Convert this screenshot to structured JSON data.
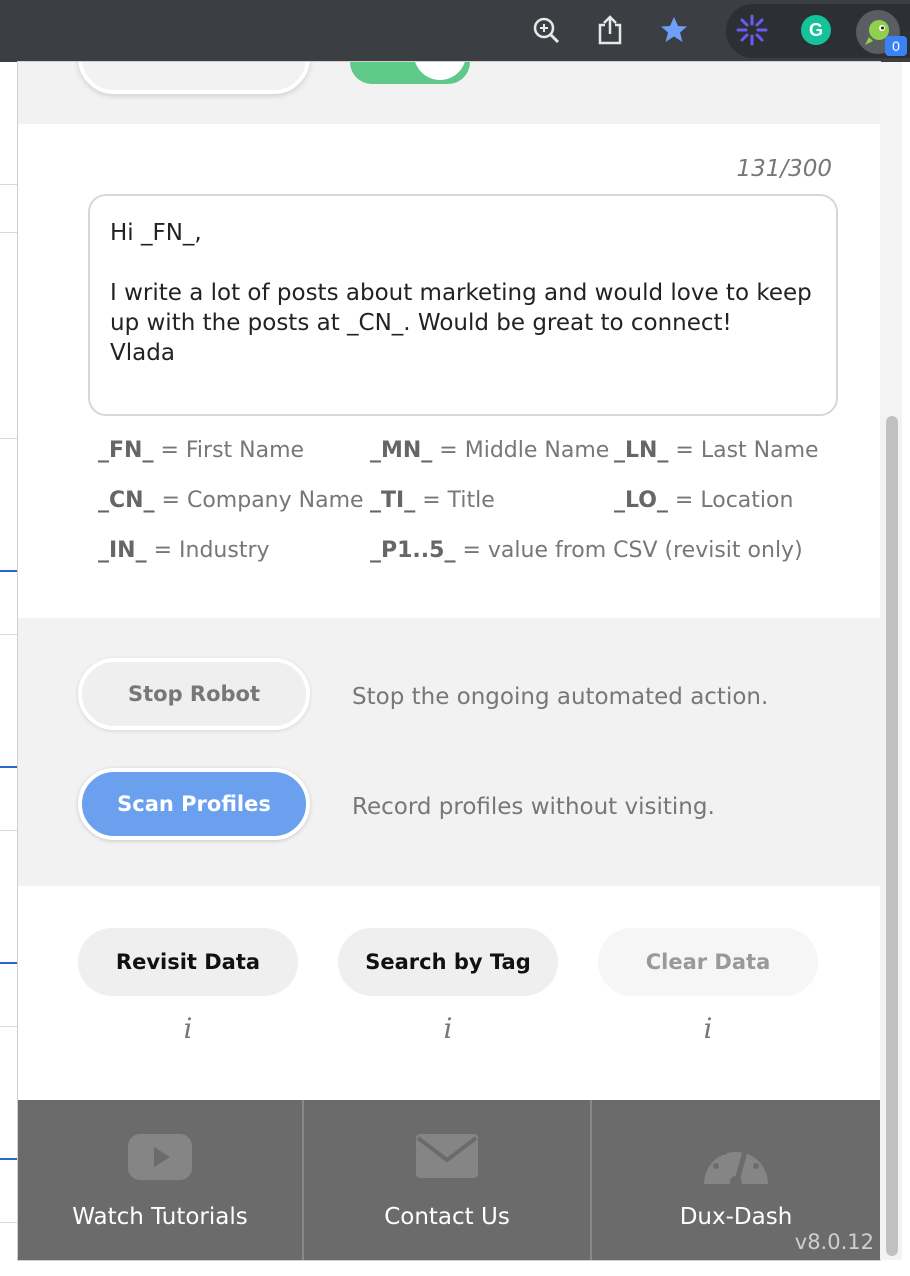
{
  "browser": {
    "badge_count": "0",
    "colors": {
      "bar": "#3b3f44",
      "star": "#6f9ef7",
      "grammarly": "#15c39a",
      "badge": "#3b82f6"
    }
  },
  "popup": {
    "counter": "131/300",
    "message": "Hi _FN_,\n\nI write a lot of posts about marketing and would love to keep up with the posts at _CN_. Would be great to connect!\nVlada",
    "placeholders": [
      {
        "token": "_FN_",
        "desc": " = First Name"
      },
      {
        "token": "_MN_",
        "desc": " = Middle Name"
      },
      {
        "token": "_LN_",
        "desc": " = Last Name"
      },
      {
        "token": "_CN_",
        "desc": " = Company Name"
      },
      {
        "token": "_TI_",
        "desc": " = Title"
      },
      {
        "token": "_LO_",
        "desc": " = Location"
      },
      {
        "token": "_IN_",
        "desc": " = Industry"
      },
      {
        "token": "_P1..5_",
        "desc": " = value from CSV (revisit only)"
      }
    ],
    "robot": {
      "stop_label": "Stop Robot",
      "stop_desc": "Stop the ongoing automated action.",
      "scan_label": "Scan Profiles",
      "scan_desc": "Record profiles without visiting."
    },
    "data_buttons": {
      "revisit": "Revisit Data",
      "search_tag": "Search by Tag",
      "clear": "Clear Data",
      "info": "i"
    },
    "footer": {
      "tutorials": "Watch Tutorials",
      "contact": "Contact Us",
      "dash": "Dux-Dash",
      "version": "v8.0.12"
    },
    "colors": {
      "accent": "#6aa0ee",
      "toggle": "#5fc98a",
      "footer": "#6b6b6b"
    }
  }
}
